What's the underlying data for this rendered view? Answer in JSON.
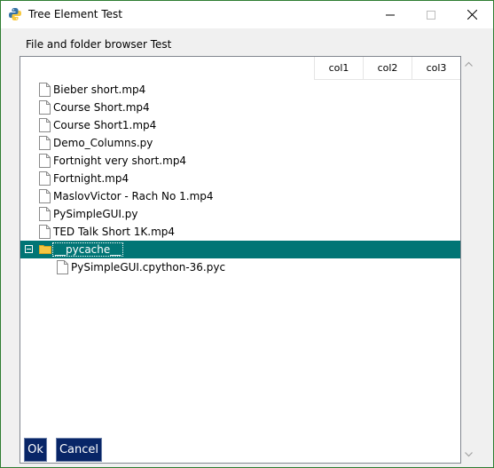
{
  "window": {
    "title": "Tree Element Test",
    "icon": "python-logo-icon",
    "controls": [
      "minimize",
      "maximize",
      "close"
    ]
  },
  "browser": {
    "label": "File and folder browser Test",
    "columns": [
      "col1",
      "col2",
      "col3"
    ],
    "items": [
      {
        "label": "Bieber short.mp4",
        "type": "file"
      },
      {
        "label": "Course Short.mp4",
        "type": "file"
      },
      {
        "label": "Course Short1.mp4",
        "type": "file"
      },
      {
        "label": "Demo_Columns.py",
        "type": "file"
      },
      {
        "label": "Fortnight very short.mp4",
        "type": "file"
      },
      {
        "label": "Fortnight.mp4",
        "type": "file"
      },
      {
        "label": "MaslovVictor - Rach No 1.mp4",
        "type": "file"
      },
      {
        "label": "PySimpleGUI.py",
        "type": "file"
      },
      {
        "label": "TED Talk Short 1K.mp4",
        "type": "file"
      },
      {
        "label": "__pycache__",
        "type": "folder",
        "expanded": true,
        "selected": true
      },
      {
        "label": "PySimpleGUI.cpython-36.pyc",
        "type": "file",
        "indent": 1
      }
    ]
  },
  "buttons": {
    "ok": "Ok",
    "cancel": "Cancel"
  },
  "colors": {
    "selection": "#017575",
    "button_bg": "#082567",
    "window_border": "#2f7d32",
    "folder": "#f5c542"
  }
}
